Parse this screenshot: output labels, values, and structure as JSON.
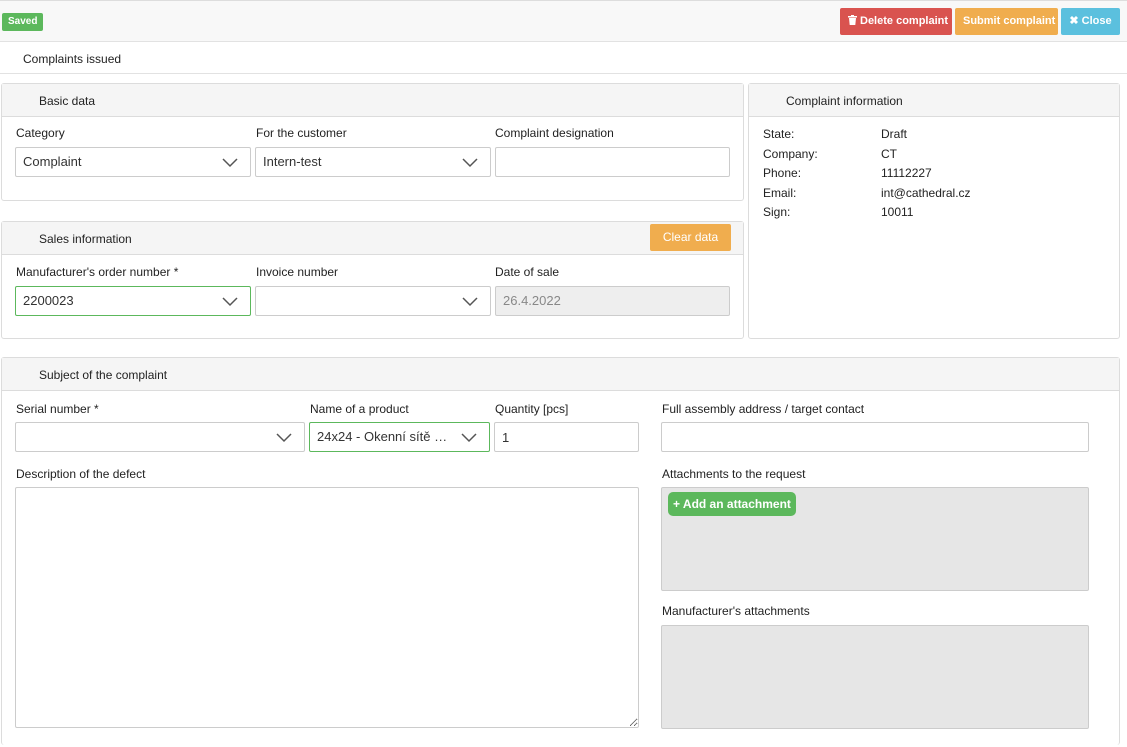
{
  "status": {
    "saved_label": "Saved"
  },
  "toolbar": {
    "delete_label": "Delete complaint",
    "submit_label": "Submit complaint",
    "close_label": "Close",
    "close_glyph": "✖",
    "delete_color": "#d9534f",
    "submit_color": "#f0ad4e",
    "close_color": "#5bc0de"
  },
  "page": {
    "title": "Complaints issued"
  },
  "basic_data": {
    "title": "Basic data",
    "category_label": "Category",
    "category_value": "Complaint",
    "customer_label": "For the customer",
    "customer_value": "Intern-test",
    "designation_label": "Complaint designation",
    "designation_value": ""
  },
  "sales_info": {
    "title": "Sales information",
    "clear_label": "Clear data",
    "order_label": "Manufacturer's order number *",
    "order_value": "2200023",
    "invoice_label": "Invoice number",
    "invoice_value": "",
    "date_label": "Date of sale",
    "date_value": "26.4.2022"
  },
  "complaint_info": {
    "title": "Complaint information",
    "rows": [
      {
        "key": "State:",
        "value": "Draft"
      },
      {
        "key": "Company:",
        "value": "CT"
      },
      {
        "key": "Phone:",
        "value": "11112227"
      },
      {
        "key": "Email:",
        "value": "int@cathedral.cz"
      },
      {
        "key": "Sign:",
        "value": "10011"
      }
    ]
  },
  "subject": {
    "title": "Subject of the complaint",
    "serial_label": "Serial number *",
    "serial_value": "",
    "product_label": "Name of a product",
    "product_value": "24x24 - Okenní sítě 2...",
    "quantity_label": "Quantity [pcs]",
    "quantity_value": "1",
    "address_label": "Full assembly address / target contact",
    "address_value": "",
    "description_label": "Description of the defect",
    "description_value": "",
    "attachments_label": "Attachments to the request",
    "add_attachment_label": "+ Add an attachment",
    "manufacturer_attachments_label": "Manufacturer's attachments"
  },
  "icons": {
    "delete": "trash-icon",
    "close": "close-icon",
    "dropdown": "chevron-down-icon"
  }
}
